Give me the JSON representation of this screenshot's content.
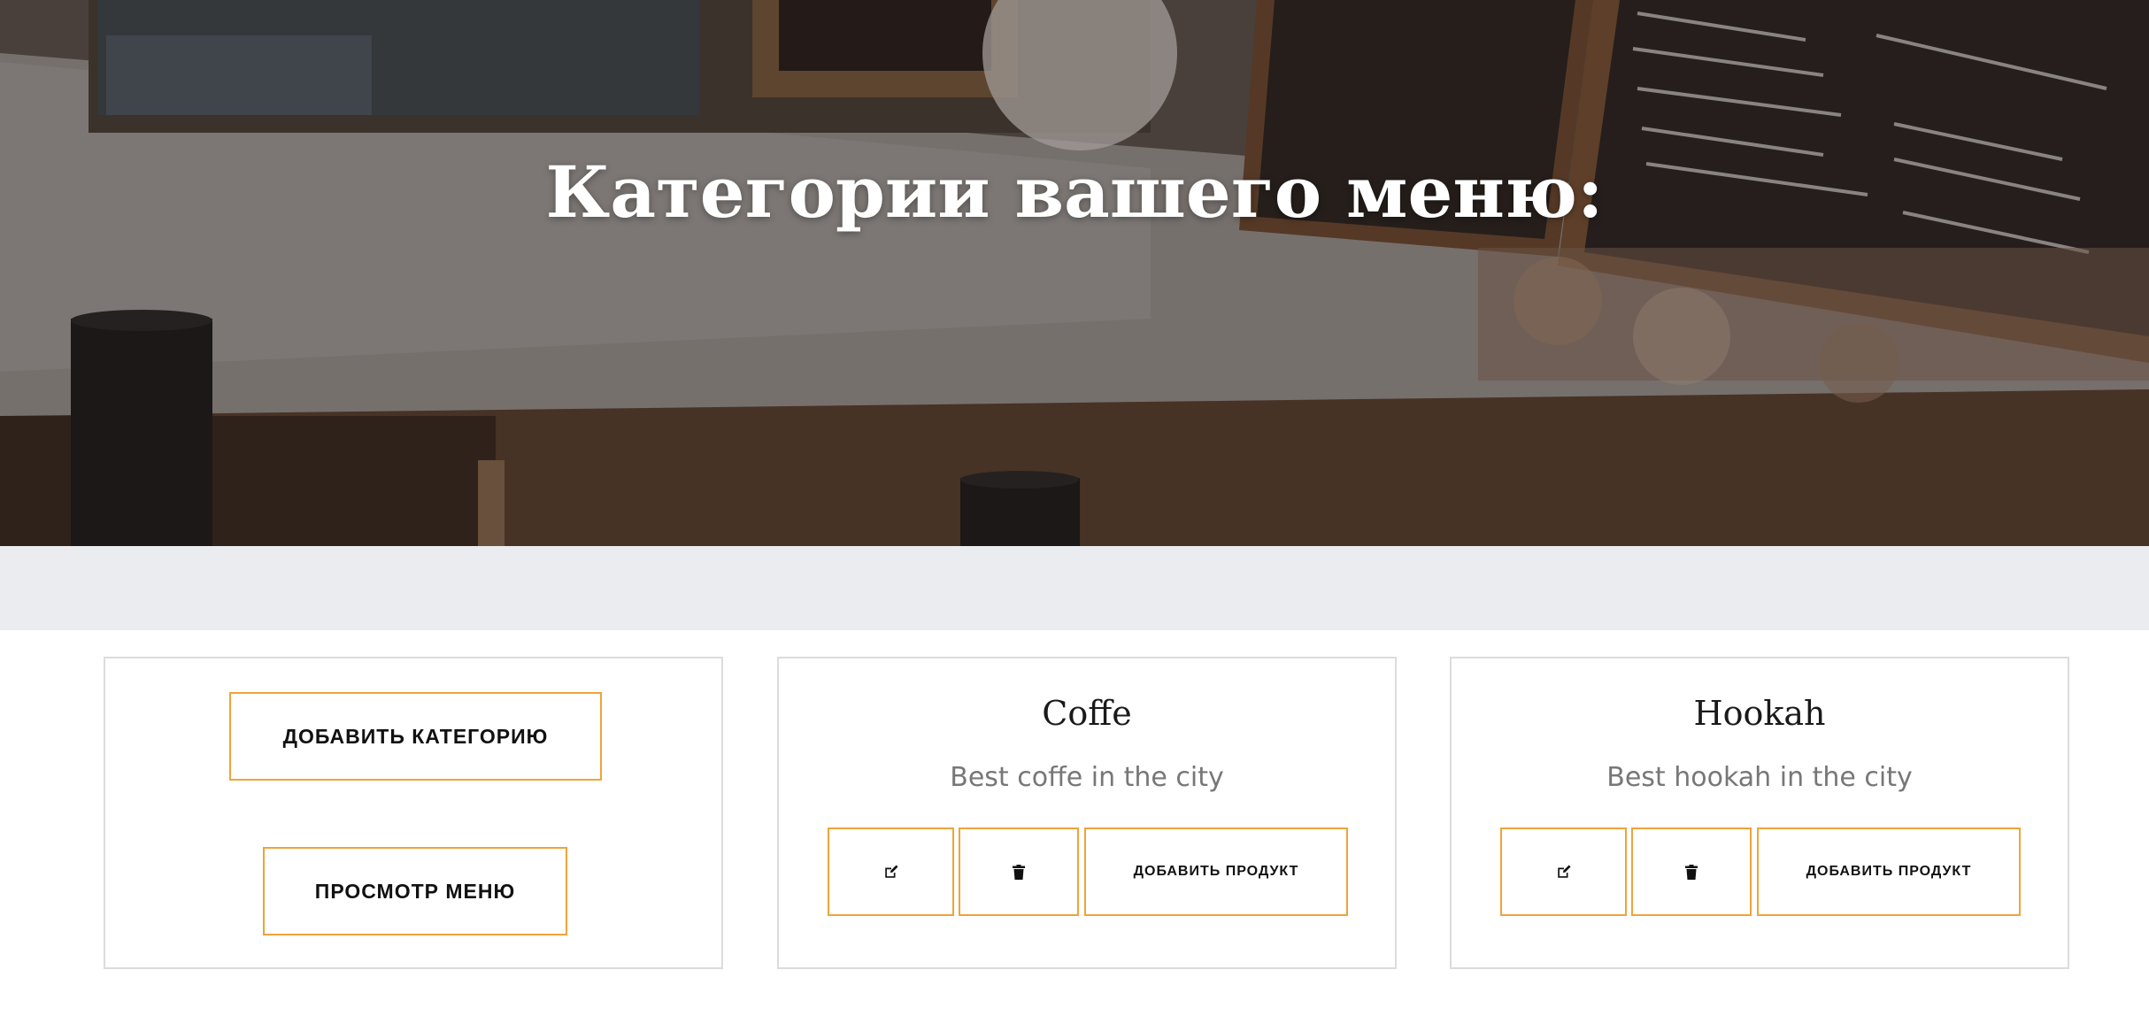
{
  "hero": {
    "title": "Категории вашего меню:"
  },
  "actions": {
    "add_category": "ДОБАВИТЬ КАТЕГОРИЮ",
    "view_menu": "ПРОСМОТР МЕНЮ"
  },
  "categories": [
    {
      "title": "Coffe",
      "description": "Best coffe in the city",
      "edit_icon": "edit-icon",
      "delete_icon": "trash-icon",
      "add_product": "ДОБАВИТЬ ПРОДУКТ"
    },
    {
      "title": "Hookah",
      "description": "Best hookah in the city",
      "edit_icon": "edit-icon",
      "delete_icon": "trash-icon",
      "add_product": "ДОБАВИТЬ ПРОДУКТ"
    }
  ],
  "colors": {
    "accent": "#f0a33a",
    "band": "#ebecef",
    "card_border": "#dcdcdc",
    "title_text": "#1a1a1a",
    "desc_text": "#777777"
  }
}
